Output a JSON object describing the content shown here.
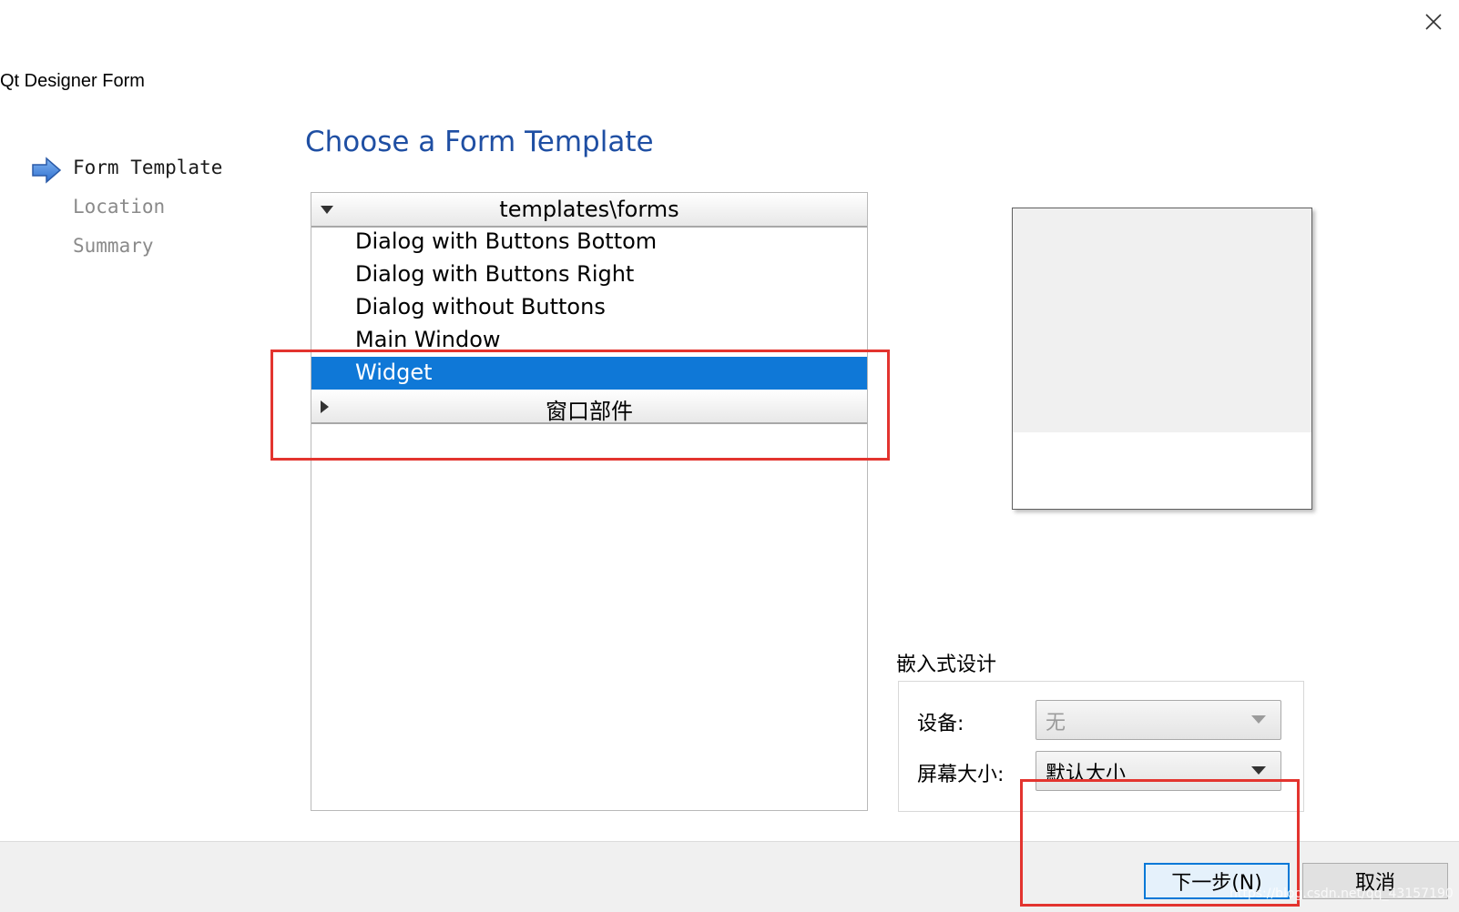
{
  "window": {
    "title": "Qt Designer Form",
    "close_icon": "close-icon"
  },
  "wizard": {
    "steps": [
      {
        "label": "Form Template",
        "active": true
      },
      {
        "label": "Location",
        "active": false
      },
      {
        "label": "Summary",
        "active": false
      }
    ],
    "heading": "Choose a Form Template"
  },
  "template_tree": {
    "groups": [
      {
        "label": "templates\\forms",
        "expanded": true,
        "items": [
          {
            "label": "Dialog with Buttons Bottom",
            "selected": false
          },
          {
            "label": "Dialog with Buttons Right",
            "selected": false
          },
          {
            "label": "Dialog without Buttons",
            "selected": false
          },
          {
            "label": "Main Window",
            "selected": false
          },
          {
            "label": "Widget",
            "selected": true
          }
        ]
      },
      {
        "label": "窗口部件",
        "expanded": false,
        "items": []
      }
    ]
  },
  "embedded_design": {
    "title": "嵌入式设计",
    "device_label": "设备:",
    "device_value": "无",
    "screen_size_label": "屏幕大小:",
    "screen_size_value": "默认大小"
  },
  "footer": {
    "next_label": "下一步(N)",
    "cancel_label": "取消"
  },
  "watermark": "https://blog.csdn.net/qq_43157190",
  "colors": {
    "accent": "#0f78d7",
    "heading": "#1f4fa3",
    "annotation": "#e3342f"
  }
}
